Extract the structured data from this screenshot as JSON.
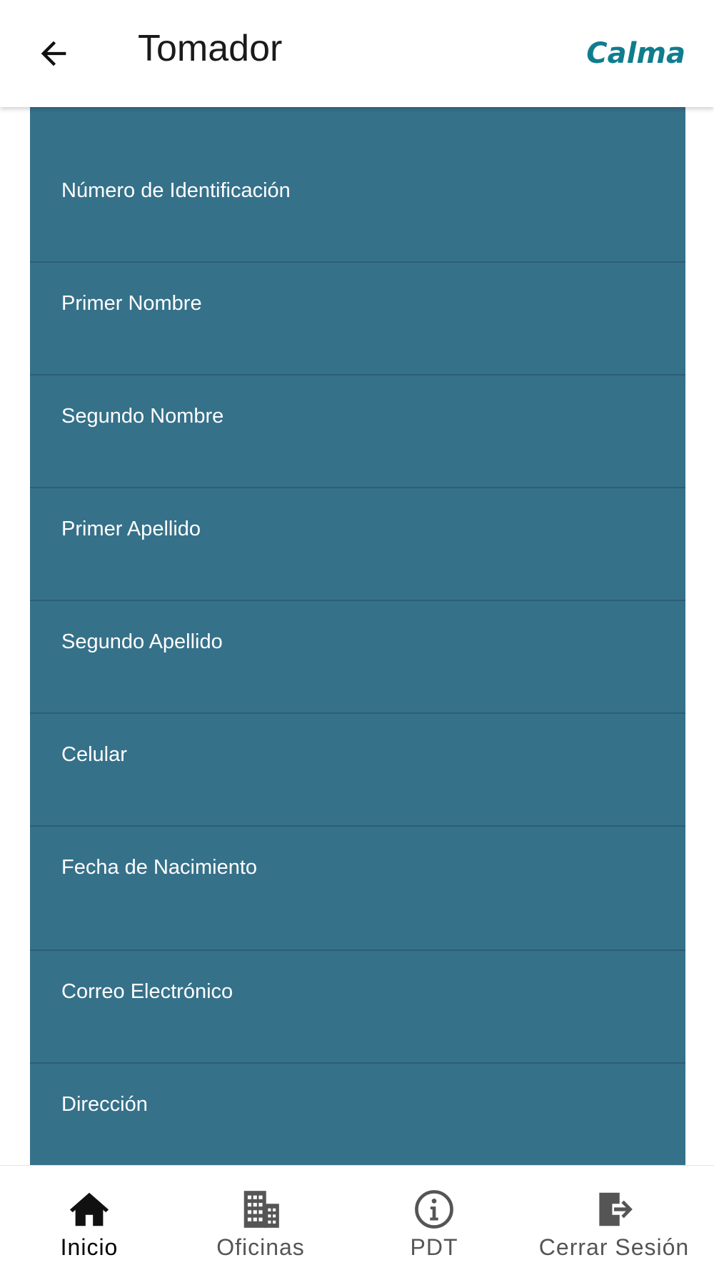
{
  "header": {
    "title": "Tomador",
    "brand": "Calma",
    "back_icon": "arrow-left-icon"
  },
  "colors": {
    "panel_background": "#36718a",
    "panel_divider": "#2c5e73",
    "brand": "#0f7d8e",
    "field_text": "#ffffff",
    "nav_active": "#000000",
    "nav_inactive": "#555555"
  },
  "form": {
    "fields": [
      {
        "label": "Número de Identificación"
      },
      {
        "label": "Primer Nombre"
      },
      {
        "label": "Segundo Nombre"
      },
      {
        "label": "Primer Apellido"
      },
      {
        "label": "Segundo Apellido"
      },
      {
        "label": "Celular"
      },
      {
        "label": "Fecha de Nacimiento"
      },
      {
        "label": "Correo Electrónico"
      },
      {
        "label": "Dirección"
      }
    ]
  },
  "bottom_nav": {
    "items": [
      {
        "label": "Inicio",
        "icon": "home-icon",
        "active": true
      },
      {
        "label": "Oficinas",
        "icon": "building-icon",
        "active": false
      },
      {
        "label": "PDT",
        "icon": "info-icon",
        "active": false
      },
      {
        "label": "Cerrar Sesión",
        "icon": "logout-icon",
        "active": false
      }
    ]
  }
}
